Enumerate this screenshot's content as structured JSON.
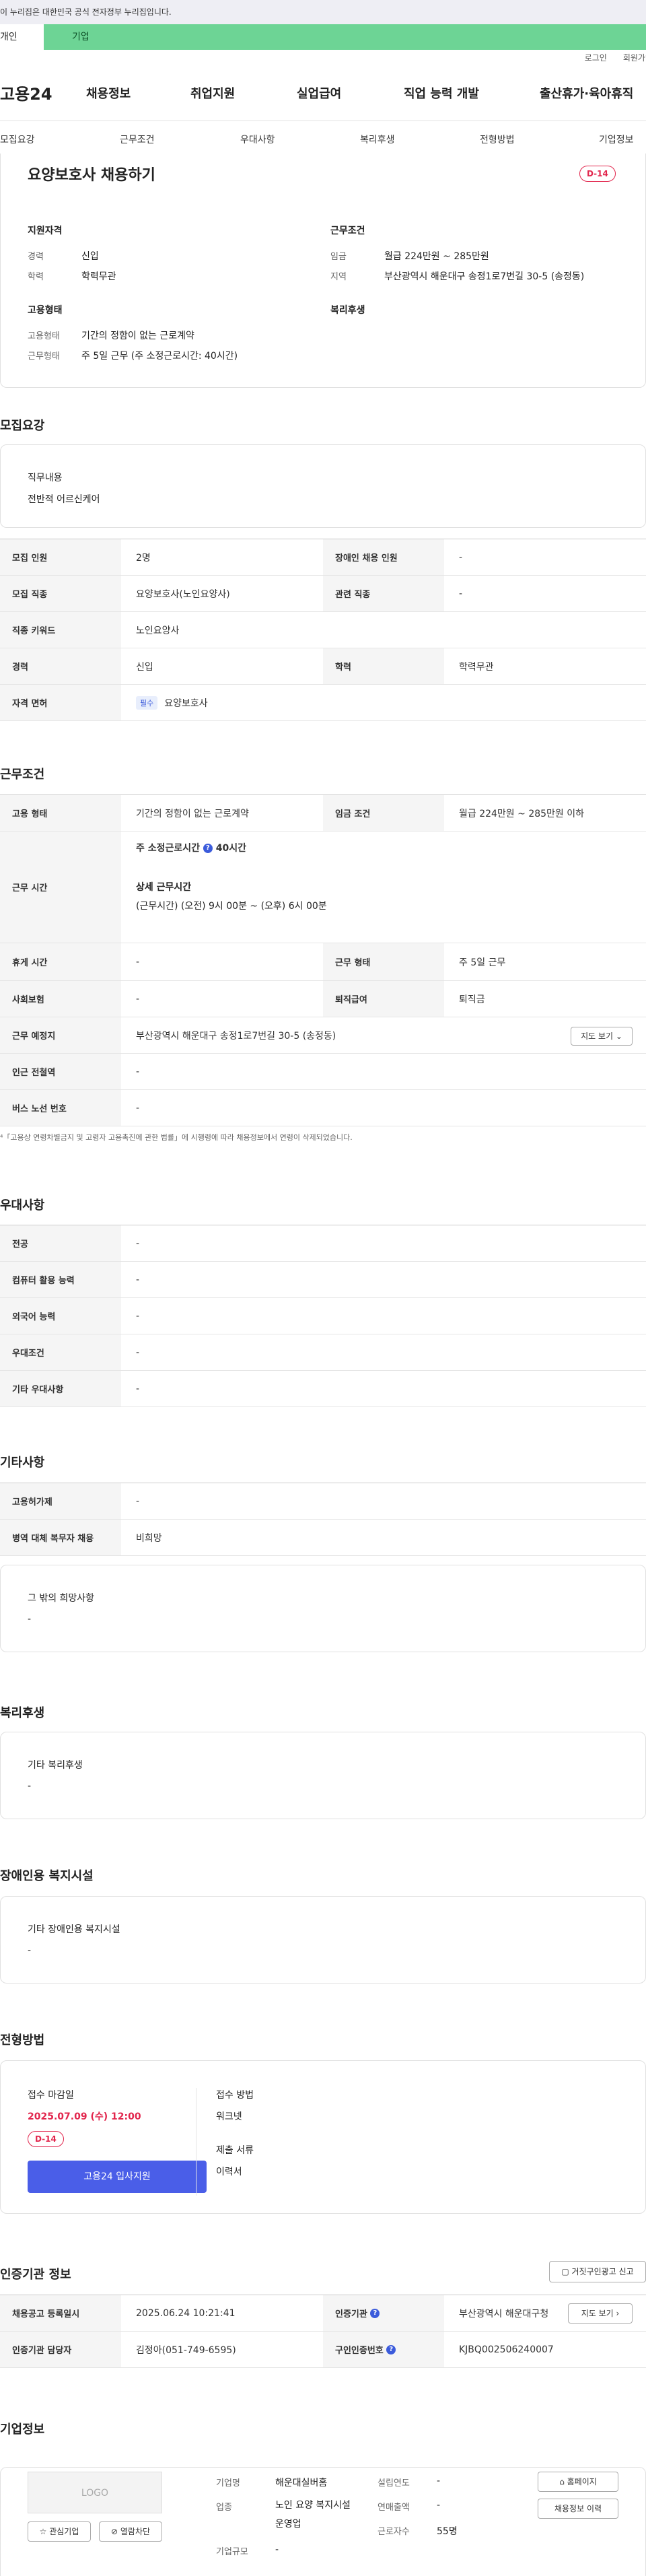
{
  "gov_banner": "이 누리집은 대한민국 공식 전자정부 누리집입니다.",
  "user_tabs": [
    "개인",
    "기업"
  ],
  "top_links": [
    "로그인",
    "회원가입"
  ],
  "logo": "고용24",
  "gnb": [
    "채용정보",
    "취업지원",
    "실업급여",
    "직업 능력 개발",
    "출산휴가·육아휴직"
  ],
  "subnav": [
    "모집요강",
    "근무조건",
    "우대사항",
    "복리후생",
    "전형방법",
    "기업정보"
  ],
  "job": {
    "title": "요양보호사 채용하기",
    "dday": "D-14"
  },
  "summary": {
    "qual_title": "지원자격",
    "career_label": "경력",
    "career": "신입",
    "edu_label": "학력",
    "edu": "학력무관",
    "cond_title": "근무조건",
    "pay_label": "임금",
    "pay": "월급 224만원 ~ 285만원",
    "area_label": "지역",
    "area": "부산광역시 해운대구 송정1로7번길 30-5 (송정동)",
    "emp_title": "고용형태",
    "emp_type_label": "고용형태",
    "emp_type": "기간의 정함이 없는 근로계약",
    "work_label": "근무형태",
    "work": "주 5일 근무 (주 소정근로시간: 40시간)",
    "welfare_title": "복리후생"
  },
  "recruit": {
    "title": "모집요강",
    "duty_label": "직무내용",
    "duty": "전반적 어르신케어",
    "headcount_label": "모집 인원",
    "headcount": "2명",
    "disabled_label": "장애인 채용 인원",
    "disabled": "-",
    "job_label": "모집 직종",
    "job": "요양보호사(노인요양사)",
    "related_label": "관련 직종",
    "related": "-",
    "keyword_label": "직종 키워드",
    "keyword": "노인요양사",
    "career_label": "경력",
    "career": "신입",
    "edu_label": "학력",
    "edu": "학력무관",
    "license_label": "자격 면허",
    "license_tag": "필수",
    "license": "요양보호사"
  },
  "work": {
    "title": "근무조건",
    "emp_label": "고용 형태",
    "emp": "기간의 정함이 없는 근로계약",
    "wage_label": "임금 조건",
    "wage": "월급 224만원 ~ 285만원 이하",
    "hours_label": "근무 시간",
    "hours_weekly_label": "주 소정근로시간",
    "hours_weekly": "40시간",
    "hours_detail_label": "상세 근무시간",
    "hours_detail": "(근무시간) (오전) 9시 00분 ~ (오후) 6시 00분",
    "rest_label": "휴게 시간",
    "rest": "-",
    "worktype_label": "근무 형태",
    "worktype": "주 5일 근무",
    "insurance_label": "사회보험",
    "insurance": "-",
    "severance_label": "퇴직급여",
    "severance": "퇴직금",
    "place_label": "근무 예정지",
    "place": "부산광역시 해운대구 송정1로7번길 30-5 (송정동)",
    "map_button": "지도 보기",
    "subway_label": "인근 전철역",
    "subway": "-",
    "bus_label": "버스 노선 번호",
    "bus": "-",
    "note": "「고용상 연령차별금지 및 고령자 고용촉진에 관한 법률」에 시행령에 따라 채용정보에서 연령이 삭제되었습니다."
  },
  "prefer": {
    "title": "우대사항",
    "rows": [
      [
        "전공",
        "-"
      ],
      [
        "컴퓨터 활용 능력",
        "-"
      ],
      [
        "외국어 능력",
        "-"
      ],
      [
        "우대조건",
        "-"
      ],
      [
        "기타 우대사항",
        "-"
      ]
    ]
  },
  "etc": {
    "title": "기타사항",
    "rows": [
      [
        "고용허가제",
        "-"
      ],
      [
        "병역 대체 복무자 채용",
        "비희망"
      ]
    ],
    "other_label": "그 밖의 희망사항",
    "other": "-"
  },
  "welfare": {
    "title": "복리후생",
    "label": "기타 복리후생",
    "value": "-"
  },
  "facility": {
    "title": "장애인용 복지시설",
    "label": "기타 장애인용 복지시설",
    "value": "-"
  },
  "process": {
    "title": "전형방법",
    "deadline_label": "접수 마감일",
    "deadline": "2025.07.09 (수) 12:00",
    "dday": "D-14",
    "apply_button": "고용24 입사지원",
    "method_label": "접수 방법",
    "method": "워크넷",
    "docs_label": "제출 서류",
    "docs": "이력서"
  },
  "agency": {
    "title": "인증기관 정보",
    "report_button": "거짓구인광고 신고",
    "reg_label": "채용공고 등록일시",
    "reg": "2025.06.24 10:21:41",
    "org_label": "인증기관",
    "org": "부산광역시 해운대구청",
    "map_button": "지도 보기",
    "manager_label": "인증기관 담당자",
    "manager": "김정아(051-749-6595)",
    "no_label": "구인인증번호",
    "no": "KJBQ002506240007"
  },
  "company": {
    "title": "기업정보",
    "logo": "LOGO",
    "fav_button": "관심기업",
    "block_button": "열람차단",
    "name_label": "기업명",
    "name": "해운대실버홈",
    "biz_label": "업종",
    "biz": "노인 요양 복지시설 운영업",
    "size_label": "기업규모",
    "size": "-",
    "year_label": "설립연도",
    "year": "-",
    "sales_label": "연매출액",
    "sales": "-",
    "emp_label": "근로자수",
    "emp": "55명",
    "home_button": "홈페이지",
    "history_button": "채용정보 이력"
  },
  "colors": {
    "accent": "#3b5bdb",
    "dday": "#e2264d",
    "green": "#6dd495"
  }
}
